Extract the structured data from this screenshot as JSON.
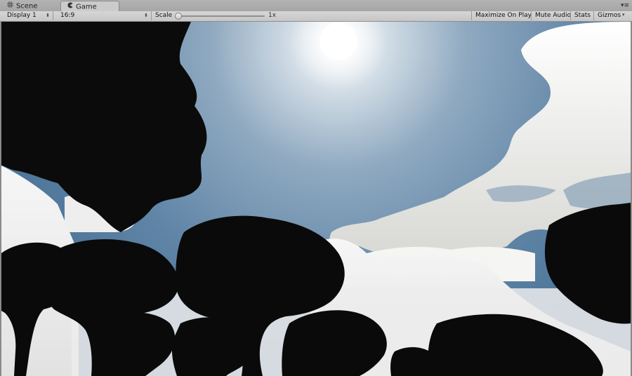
{
  "tabs": [
    {
      "label": "Scene",
      "icon": "grid-icon"
    },
    {
      "label": "Game",
      "icon": "pacman-icon"
    }
  ],
  "toolbar": {
    "display": "Display 1",
    "aspect": "16:9",
    "scale_label": "Scale",
    "scale_value": "1x",
    "maximize": "Maximize On Play",
    "mute": "Mute Audio",
    "stats": "Stats",
    "gizmos": "Gizmos"
  },
  "colors": {
    "sky_top": "#3f6a92",
    "sky_mid": "#7d9bb7",
    "sun": "#ffffff",
    "cloud": "#f2f2f2",
    "silhouette": "#0c0c0c",
    "fog": "#ededed"
  }
}
